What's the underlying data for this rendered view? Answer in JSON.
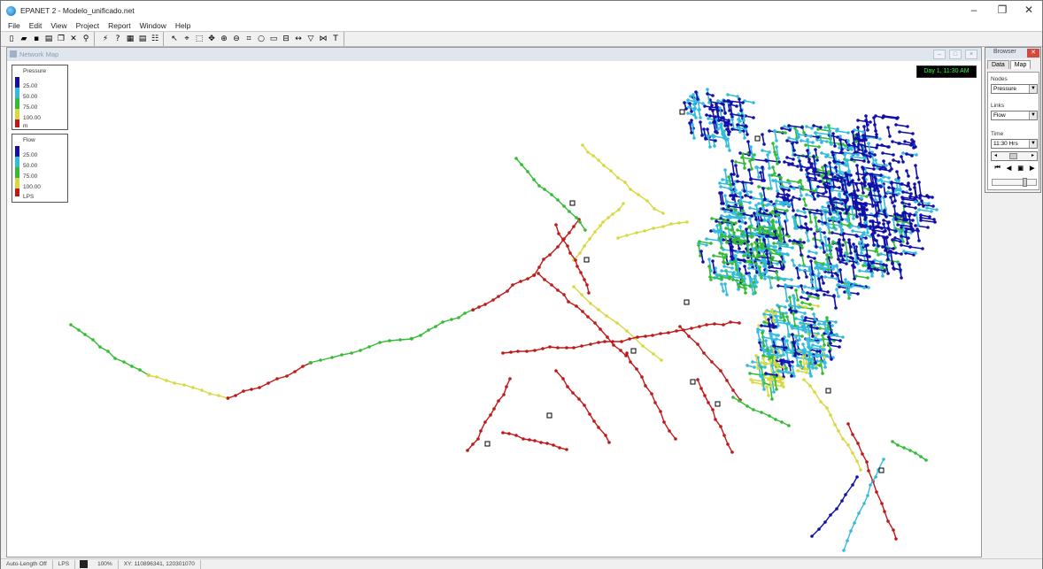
{
  "window": {
    "title": "EPANET 2 - Modelo_unificado.net"
  },
  "menu": [
    "File",
    "Edit",
    "View",
    "Project",
    "Report",
    "Window",
    "Help"
  ],
  "toolbar": {
    "groups": [
      [
        "new-icon",
        "open-icon",
        "save-icon",
        "print-icon",
        "copy-icon",
        "delete-icon",
        "find-icon"
      ],
      [
        "run-icon",
        "query-icon",
        "graph-icon",
        "table-icon",
        "options-icon"
      ],
      [
        "select-object-icon",
        "select-vertex-icon",
        "select-region-icon",
        "pan-icon",
        "zoom-in-icon",
        "zoom-out-icon",
        "full-extent-icon",
        "add-junction-icon",
        "add-reservoir-icon",
        "add-tank-icon",
        "add-pipe-icon",
        "add-pump-icon",
        "add-valve-icon",
        "add-label-icon"
      ]
    ]
  },
  "map_window": {
    "title": "Network Map",
    "time_display": "Day 1, 11:30 AM",
    "legend_pressure": {
      "title": "Pressure",
      "values": [
        "25.00",
        "50.00",
        "75.00",
        "100.00"
      ],
      "unit": "m"
    },
    "legend_flow": {
      "title": "Flow",
      "values": [
        "25.00",
        "50.00",
        "75.00",
        "100.00"
      ],
      "unit": "LPS"
    },
    "colors": {
      "band1": "#1010a8",
      "band2": "#33bbdd",
      "band3": "#33bb33",
      "band4": "#d8d840",
      "band5": "#c01818"
    }
  },
  "browser": {
    "title": "Browser",
    "tabs": [
      "Data",
      "Map"
    ],
    "active_tab": "Map",
    "nodes_label": "Nodes",
    "nodes_value": "Pressure",
    "links_label": "Links",
    "links_value": "Flow",
    "time_label": "Time",
    "time_value": "11:30 Hrs"
  },
  "status": {
    "auto_length": "Auto-Length Off",
    "flow_units": "LPS",
    "zoom": "100%",
    "xy": "XY: 110896341, 120301070"
  }
}
